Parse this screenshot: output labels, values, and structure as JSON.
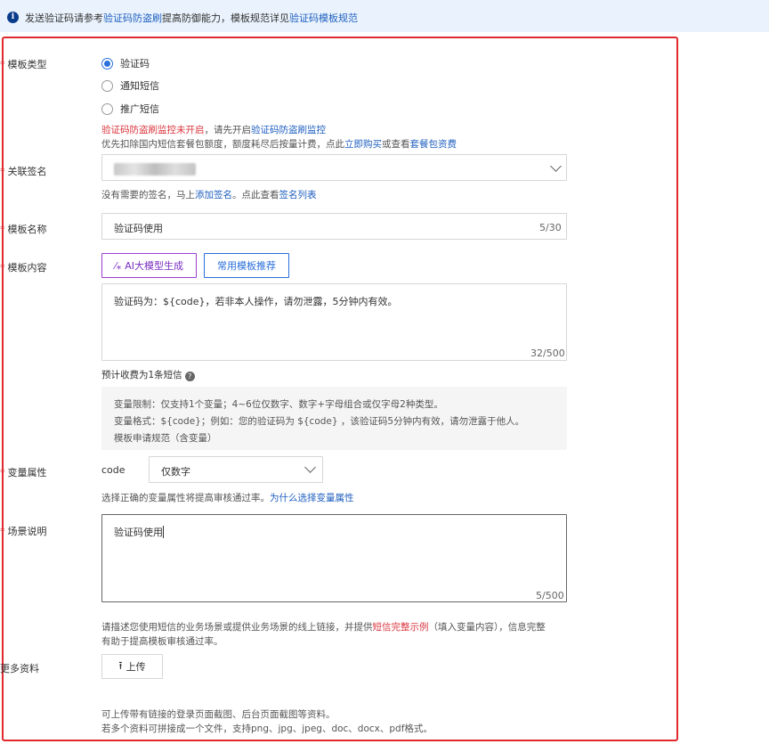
{
  "banner": {
    "part1": "发送验证码请参考",
    "link1": "验证码防盗刷",
    "part2": "提高防御能力，模板规范详见",
    "link2": "验证码模板规范"
  },
  "template_type": {
    "label": "模板类型",
    "options": [
      "验证码",
      "通知短信",
      "推广短信"
    ],
    "selected": "验证码",
    "warning_red": "验证码防盗刷监控未开启",
    "warning_mid": "，请先开启",
    "warning_link": "验证码防盗刷监控",
    "billing_text": "优先扣除国内短信套餐包额度，额度耗尽后按量计费，点此",
    "billing_link1": "立即购买",
    "billing_mid": "或查看",
    "billing_link2": "套餐包资费"
  },
  "signature": {
    "label": "关联签名",
    "help_text": "没有需要的签名，马上",
    "help_link1": "添加签名",
    "help_mid": "。点此查看",
    "help_link2": "签名列表"
  },
  "template_name": {
    "label": "模板名称",
    "value": "验证码使用",
    "counter": "5/30"
  },
  "template_content": {
    "label": "模板内容",
    "ai_button": "AI大模型生成",
    "common_button": "常用模板推荐",
    "value": "验证码为：${code}，若非本人操作，请勿泄露，5分钟内有效。",
    "counter": "32/500",
    "estimate": "预计收费为1条短信",
    "rule_limit": "变量限制：仅支持1个变量；4~6位仅数字、数字+字母组合或仅字母2种类型。",
    "rule_format": "变量格式：${code}；例如：您的验证码为 ${code} ，该验证码5分钟内有效，请勿泄露于他人。",
    "rule_link": "模板申请规范（含变量）"
  },
  "variable": {
    "label": "变量属性",
    "name": "code",
    "selected": "仅数字",
    "help_text": "选择正确的变量属性将提高审核通过率。",
    "help_link": "为什么选择变量属性"
  },
  "scene": {
    "label": "场景说明",
    "value": "验证码使用",
    "counter": "5/500",
    "help_part1": "请描述您使用短信的业务场景或提供业务场景的线上链接，并提供",
    "help_link": "短信完整示例",
    "help_part2": "（填入变量内容），信息完整",
    "help_line2": "有助于提高模板审核通过率。"
  },
  "more": {
    "label": "更多资料",
    "upload_label": "上传",
    "help_line1": "可上传带有链接的登录页面截图、后台页面截图等资料。",
    "help_line2": "若多个资料可拼接成一个文件，支持png、jpg、jpeg、doc、docx、pdf格式。"
  },
  "colors": {
    "accent": "#2a6fdb",
    "link": "#1f5fbf",
    "required": "#d9363e",
    "highlight_border": "#e0282e",
    "ai_purple": "#9b3fcf"
  }
}
